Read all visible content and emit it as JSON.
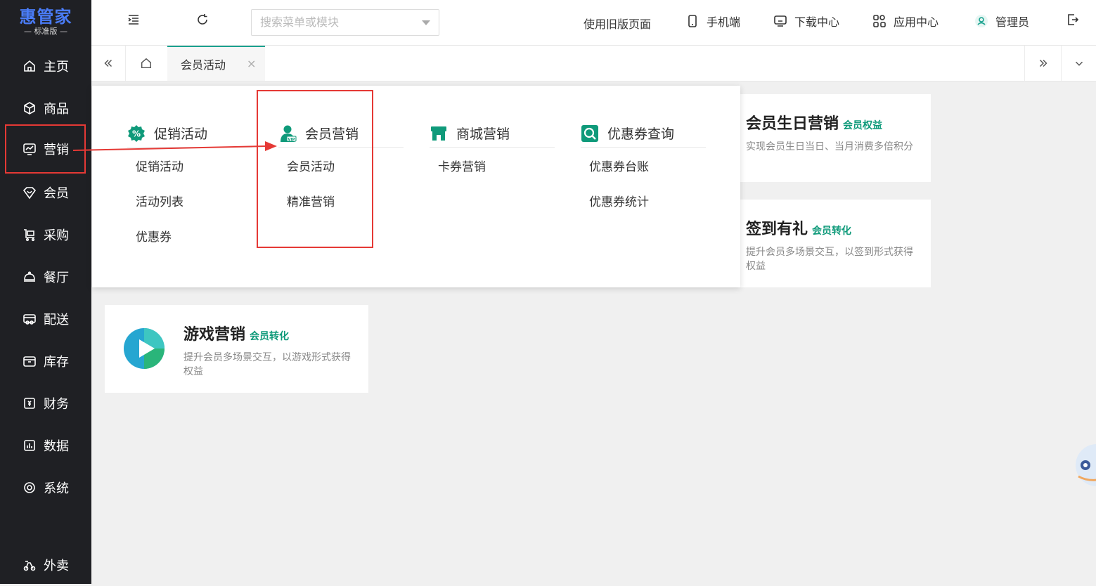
{
  "app": {
    "logo": "惠管家",
    "edition": "— 标准版 —"
  },
  "sidebar": {
    "items": [
      {
        "label": "主页",
        "icon": "home-icon"
      },
      {
        "label": "商品",
        "icon": "box-icon"
      },
      {
        "label": "营销",
        "icon": "monitor-chart-icon"
      },
      {
        "label": "会员",
        "icon": "diamond-heart-icon"
      },
      {
        "label": "采购",
        "icon": "cart-icon"
      },
      {
        "label": "餐厅",
        "icon": "cloche-icon"
      },
      {
        "label": "配送",
        "icon": "delivery-icon"
      },
      {
        "label": "库存",
        "icon": "inventory-icon"
      },
      {
        "label": "财务",
        "icon": "finance-icon"
      },
      {
        "label": "数据",
        "icon": "bar-chart-icon"
      },
      {
        "label": "系统",
        "icon": "settings-icon"
      }
    ],
    "bottom_item": {
      "label": "外卖",
      "icon": "scooter-icon"
    }
  },
  "header": {
    "search_placeholder": "搜索菜单或模块",
    "links": {
      "old_version": "使用旧版页面",
      "mobile": "手机端",
      "download": "下载中心",
      "apps": "应用中心",
      "user": "管理员"
    }
  },
  "tabs": {
    "active": "会员活动",
    "close": "×"
  },
  "cards": [
    {
      "title": "会员生日营销",
      "tag": "会员权益",
      "desc": "实现会员生日当日、当月消费多倍积分"
    },
    {
      "title": "签到有礼",
      "tag": "会员转化",
      "desc": "提升会员多场景交互，以签到形式获得权益"
    },
    {
      "title": "游戏营销",
      "tag": "会员转化",
      "desc": "提升会员多场景交互，以游戏形式获得权益"
    }
  ],
  "menu": {
    "columns": [
      {
        "title": "促销活动",
        "items": [
          "促销活动",
          "活动列表",
          "优惠券"
        ]
      },
      {
        "title": "会员营销",
        "items": [
          "会员活动",
          "精准营销"
        ]
      },
      {
        "title": "商城营销",
        "items": [
          "卡券营销"
        ]
      },
      {
        "title": "优惠券查询",
        "items": [
          "优惠券台账",
          "优惠券统计"
        ]
      }
    ]
  },
  "colors": {
    "sidebar_bg": "#1f2024",
    "accent": "#1aa28f",
    "highlight": "#e53935",
    "logo": "#4a7cf7"
  }
}
